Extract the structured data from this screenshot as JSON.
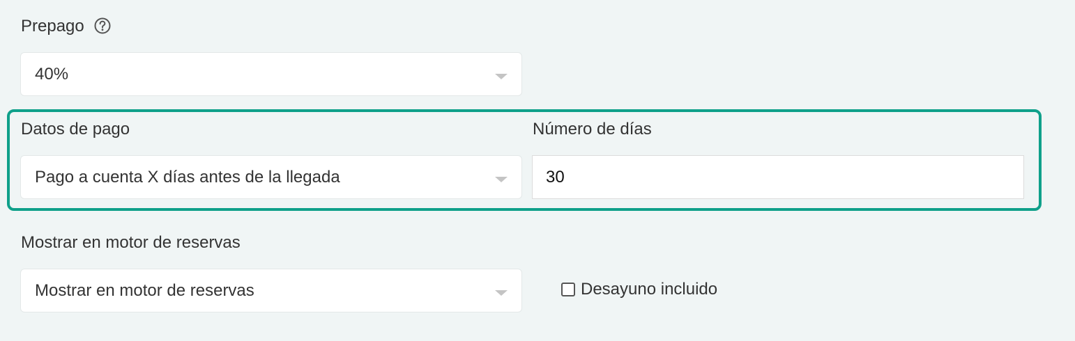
{
  "prepago": {
    "label": "Prepago",
    "value": "40%"
  },
  "datos_pago": {
    "label": "Datos de pago",
    "value": "Pago a cuenta X días antes de la llegada"
  },
  "numero_dias": {
    "label": "Número de días",
    "value": "30"
  },
  "motor_reservas": {
    "label": "Mostrar en motor de reservas",
    "value": "Mostrar en motor de reservas"
  },
  "desayuno": {
    "label": "Desayuno incluido",
    "checked": false
  },
  "colors": {
    "highlight": "#0fa08a",
    "background": "#f0f5f5"
  },
  "icons": {
    "help": "question-circle-icon",
    "dropdown": "caret-down-icon"
  }
}
